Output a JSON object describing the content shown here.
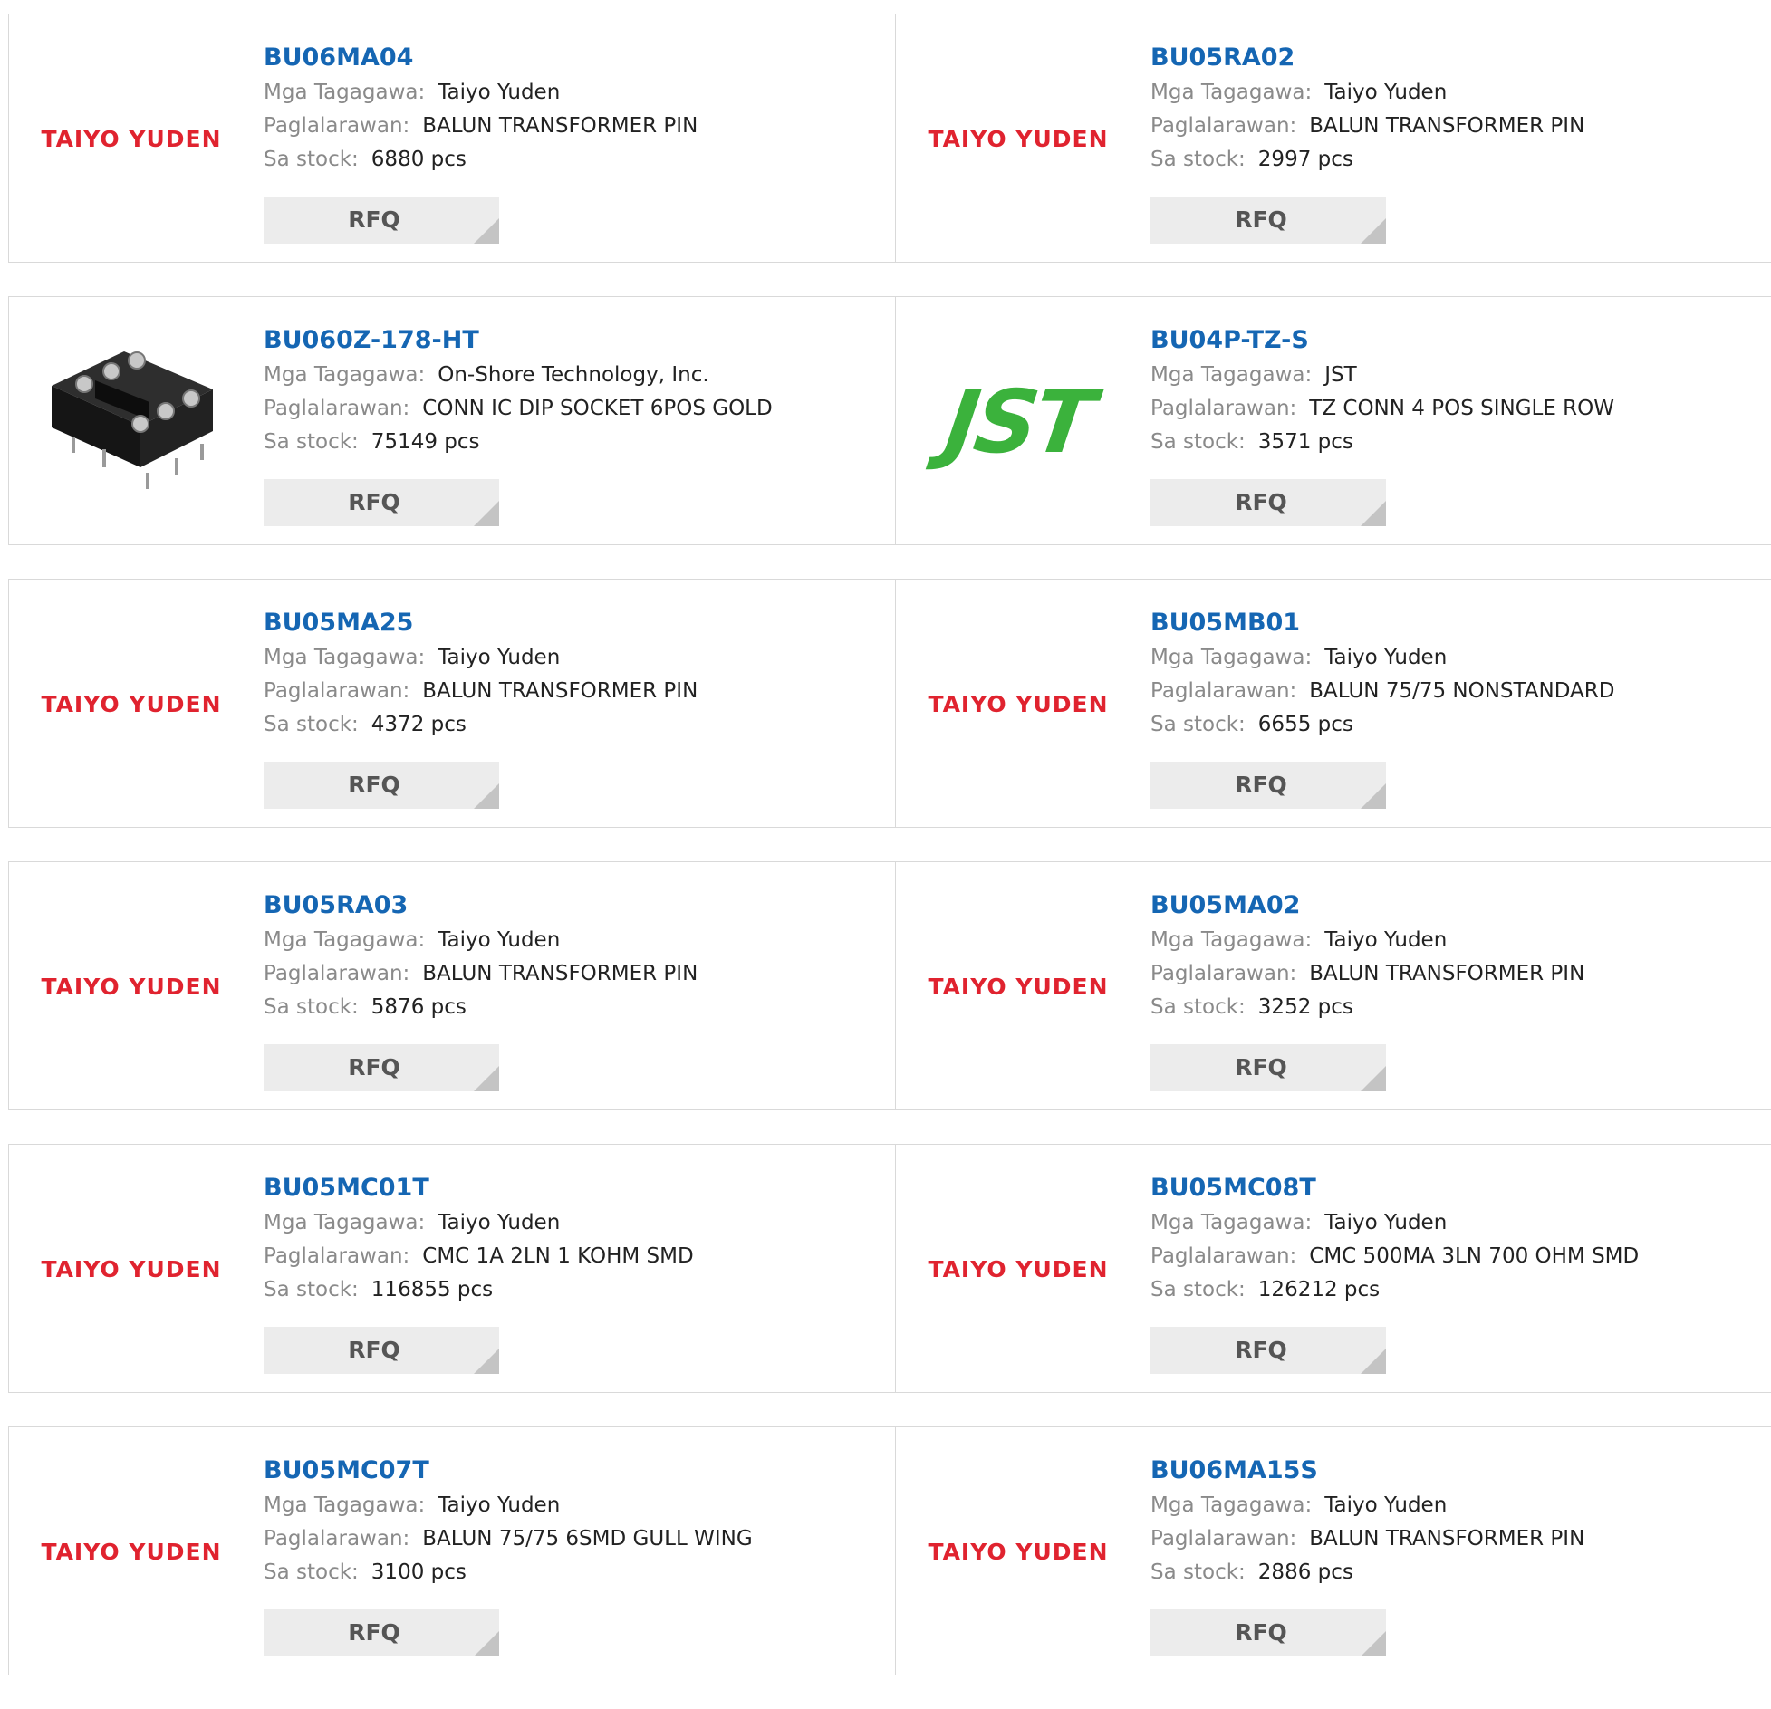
{
  "labels": {
    "manufacturer": "Mga Tagagawa:",
    "description": "Paglalarawan:",
    "stock": "Sa stock:",
    "rfq": "RFQ"
  },
  "colors": {
    "part_link": "#1566b3",
    "taiyo_logo": "#e0232f",
    "jst_logo": "#3bb23c",
    "rfq_bg": "#ececec"
  },
  "products": [
    {
      "part": "BU06MA04",
      "logo": "TAIYO YUDEN",
      "logo_type": "taiyo",
      "manufacturer": "Taiyo Yuden",
      "description": "BALUN TRANSFORMER PIN",
      "stock": "6880 pcs"
    },
    {
      "part": "BU05RA02",
      "logo": "TAIYO YUDEN",
      "logo_type": "taiyo",
      "manufacturer": "Taiyo Yuden",
      "description": "BALUN TRANSFORMER PIN",
      "stock": "2997 pcs"
    },
    {
      "part": "BU060Z-178-HT",
      "logo": "",
      "logo_type": "socket-image",
      "manufacturer": "On-Shore Technology, Inc.",
      "description": "CONN IC DIP SOCKET 6POS GOLD",
      "stock": "75149 pcs"
    },
    {
      "part": "BU04P-TZ-S",
      "logo": "JST",
      "logo_type": "jst",
      "manufacturer": "JST",
      "description": "TZ CONN 4 POS SINGLE ROW",
      "stock": "3571 pcs"
    },
    {
      "part": "BU05MA25",
      "logo": "TAIYO YUDEN",
      "logo_type": "taiyo",
      "manufacturer": "Taiyo Yuden",
      "description": "BALUN TRANSFORMER PIN",
      "stock": "4372 pcs"
    },
    {
      "part": "BU05MB01",
      "logo": "TAIYO YUDEN",
      "logo_type": "taiyo",
      "manufacturer": "Taiyo Yuden",
      "description": "BALUN 75/75 NONSTANDARD",
      "stock": "6655 pcs"
    },
    {
      "part": "BU05RA03",
      "logo": "TAIYO YUDEN",
      "logo_type": "taiyo",
      "manufacturer": "Taiyo Yuden",
      "description": "BALUN TRANSFORMER PIN",
      "stock": "5876 pcs"
    },
    {
      "part": "BU05MA02",
      "logo": "TAIYO YUDEN",
      "logo_type": "taiyo",
      "manufacturer": "Taiyo Yuden",
      "description": "BALUN TRANSFORMER PIN",
      "stock": "3252 pcs"
    },
    {
      "part": "BU05MC01T",
      "logo": "TAIYO YUDEN",
      "logo_type": "taiyo",
      "manufacturer": "Taiyo Yuden",
      "description": "CMC 1A 2LN 1 KOHM SMD",
      "stock": "116855 pcs"
    },
    {
      "part": "BU05MC08T",
      "logo": "TAIYO YUDEN",
      "logo_type": "taiyo",
      "manufacturer": "Taiyo Yuden",
      "description": "CMC 500MA 3LN 700 OHM SMD",
      "stock": "126212 pcs"
    },
    {
      "part": "BU05MC07T",
      "logo": "TAIYO YUDEN",
      "logo_type": "taiyo",
      "manufacturer": "Taiyo Yuden",
      "description": "BALUN 75/75 6SMD GULL WING",
      "stock": "3100 pcs"
    },
    {
      "part": "BU06MA15S",
      "logo": "TAIYO YUDEN",
      "logo_type": "taiyo",
      "manufacturer": "Taiyo Yuden",
      "description": "BALUN TRANSFORMER PIN",
      "stock": "2886 pcs"
    }
  ]
}
